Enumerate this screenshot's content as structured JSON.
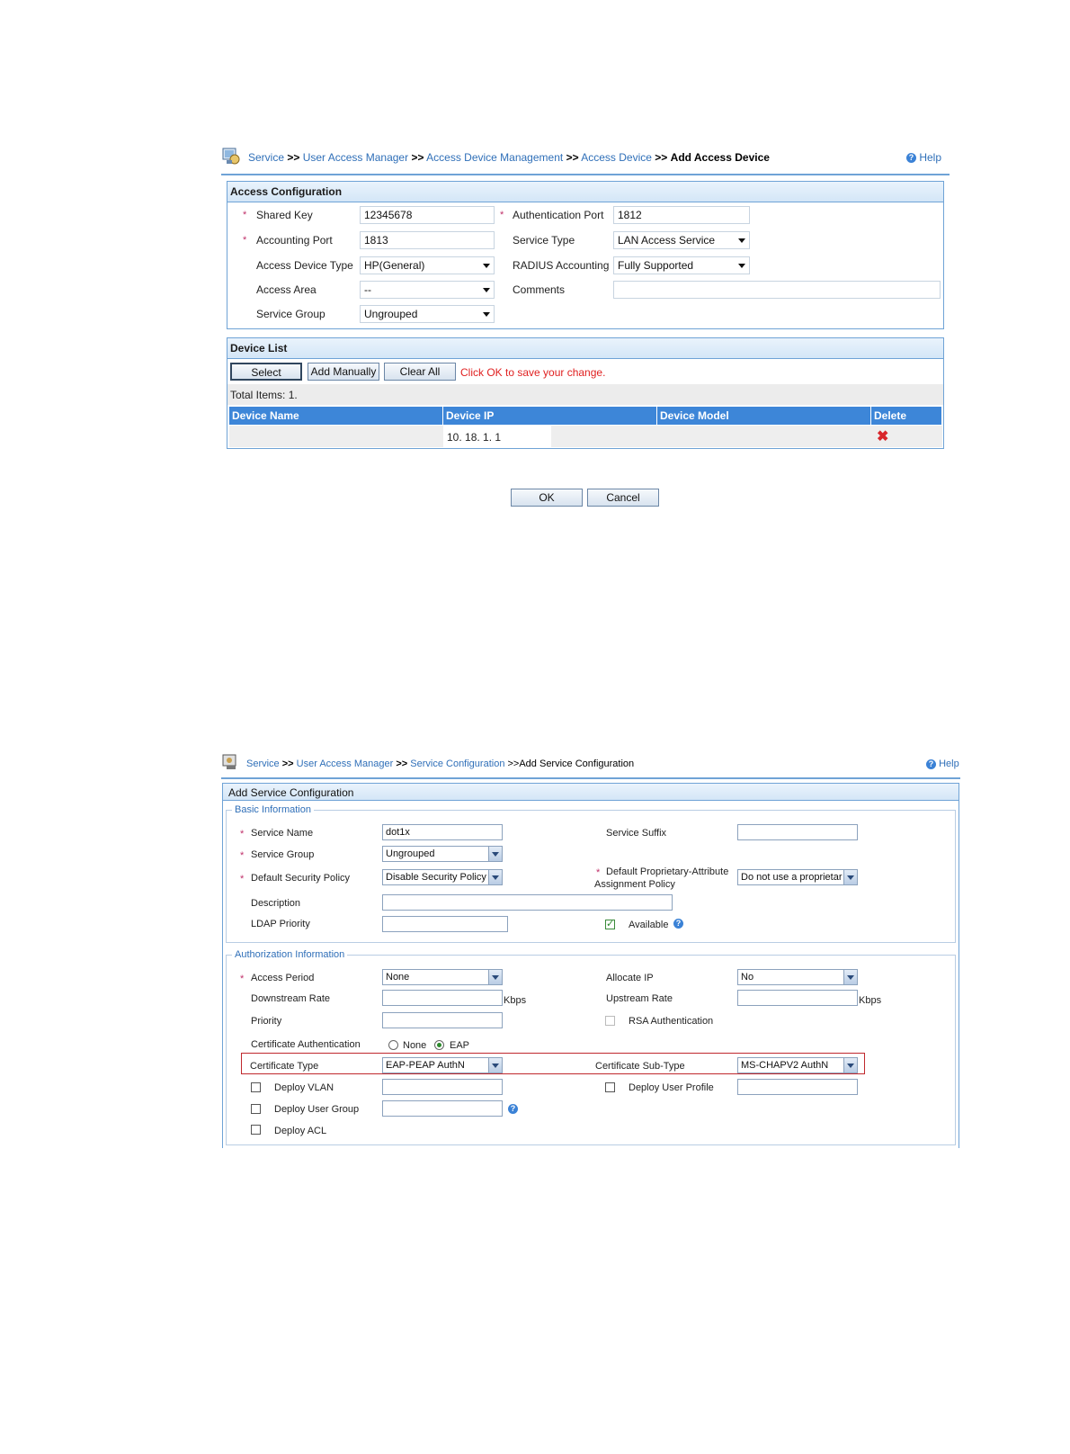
{
  "screen1": {
    "breadcrumb": {
      "items": [
        "Service",
        "User Access Manager",
        "Access Device Management",
        "Access Device"
      ],
      "separator": ">>",
      "current": "Add Access Device"
    },
    "help": "Help",
    "access_config": {
      "title": "Access Configuration",
      "shared_key_label": "Shared Key",
      "shared_key_value": "12345678",
      "auth_port_label": "Authentication Port",
      "auth_port_value": "1812",
      "acct_port_label": "Accounting Port",
      "acct_port_value": "1813",
      "service_type_label": "Service Type",
      "service_type_value": "LAN Access Service",
      "device_type_label": "Access Device Type",
      "device_type_value": "HP(General)",
      "radius_acct_label": "RADIUS Accounting",
      "radius_acct_value": "Fully Supported",
      "access_area_label": "Access Area",
      "access_area_value": "--",
      "comments_label": "Comments",
      "comments_value": "",
      "service_group_label": "Service Group",
      "service_group_value": "Ungrouped"
    },
    "device_list": {
      "title": "Device List",
      "select_button": "Select",
      "add_manually_button": "Add Manually",
      "clear_all_button": "Clear All",
      "notice": "Click OK to save your change.",
      "total_items": "Total Items: 1.",
      "columns": [
        "Device Name",
        "Device IP",
        "Device Model",
        "Delete"
      ],
      "rows": [
        {
          "name": "",
          "ip": "10. 18. 1. 1",
          "model": ""
        }
      ]
    },
    "ok_button": "OK",
    "cancel_button": "Cancel"
  },
  "screen2": {
    "breadcrumb": {
      "items": [
        "Service",
        "User Access Manager",
        "Service Configuration"
      ],
      "separator": ">>",
      "current": ">>Add Service Configuration"
    },
    "help": "Help",
    "title": "Add Service Configuration",
    "basic": {
      "legend": "Basic Information",
      "service_name_label": "Service Name",
      "service_name_value": "dot1x",
      "service_suffix_label": "Service Suffix",
      "service_suffix_value": "",
      "service_group_label": "Service Group",
      "service_group_value": "Ungrouped",
      "security_policy_label": "Default Security Policy",
      "security_policy_value": "Disable Security Policy",
      "proprietary_label_1": "Default Proprietary-Attribute",
      "proprietary_label_2": "Assignment Policy",
      "proprietary_value": "Do not use a proprietar",
      "description_label": "Description",
      "description_value": "",
      "ldap_label": "LDAP Priority",
      "ldap_value": "",
      "available_label": "Available"
    },
    "auth": {
      "legend": "Authorization Information",
      "access_period_label": "Access Period",
      "access_period_value": "None",
      "allocate_ip_label": "Allocate IP",
      "allocate_ip_value": "No",
      "downstream_label": "Downstream Rate",
      "upstream_label": "Upstream Rate",
      "kbps": "Kbps",
      "priority_label": "Priority",
      "rsa_label": "RSA Authentication",
      "cert_auth_label": "Certificate Authentication",
      "radio_none": "None",
      "radio_eap": "EAP",
      "cert_type_label": "Certificate Type",
      "cert_type_value": "EAP-PEAP AuthN",
      "cert_subtype_label": "Certificate Sub-Type",
      "cert_subtype_value": "MS-CHAPV2 AuthN",
      "deploy_vlan_label": "Deploy VLAN",
      "deploy_user_profile_label": "Deploy User Profile",
      "deploy_user_group_label": "Deploy User Group",
      "deploy_acl_label": "Deploy ACL"
    },
    "highlight_color": "#c0282d"
  }
}
